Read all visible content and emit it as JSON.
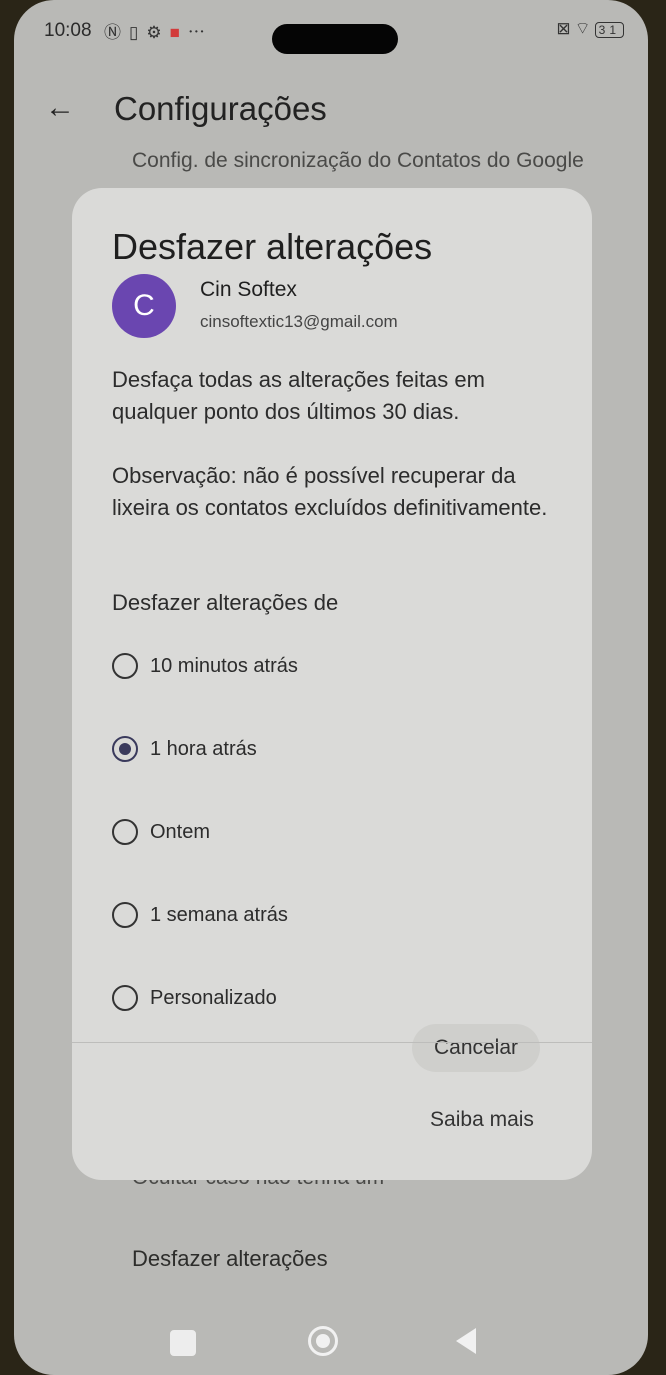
{
  "status_bar": {
    "time": "10:08",
    "left_icons": [
      "nfc-icon",
      "sim-icon",
      "gear-icon",
      "app-icon",
      "more-icon"
    ],
    "right_icons": [
      "no-sim-icon",
      "wifi-icon",
      "battery-icon"
    ],
    "battery_level": "31"
  },
  "appbar": {
    "title": "Configurações"
  },
  "background": {
    "item_top": "Config. de sincronização do Contatos do Google",
    "item_hidden": "Ocultar caso não tenha um",
    "item_bottom": "Desfazer alterações"
  },
  "dialog": {
    "title": "Desfazer alterações",
    "account": {
      "avatar_letter": "C",
      "avatar_color": "#6a46b0",
      "name": "Cin Softex",
      "email": "cinsoftextic13@gmail.com"
    },
    "description": "Desfaça todas as alterações feitas em qualquer ponto dos últimos 30 dias.",
    "note": "Observação: não é possível recuperar da lixeira os contatos excluídos definitivamente.",
    "section_label": "Desfazer alterações de",
    "options": [
      {
        "label": "10 minutos atrás",
        "selected": false
      },
      {
        "label": "1 hora atrás",
        "selected": true
      },
      {
        "label": "Ontem",
        "selected": false
      },
      {
        "label": "1 semana atrás",
        "selected": false
      },
      {
        "label": "Personalizado",
        "selected": false
      }
    ],
    "cancel_label": "Cancelar",
    "learn_more_label": "Saiba mais"
  }
}
